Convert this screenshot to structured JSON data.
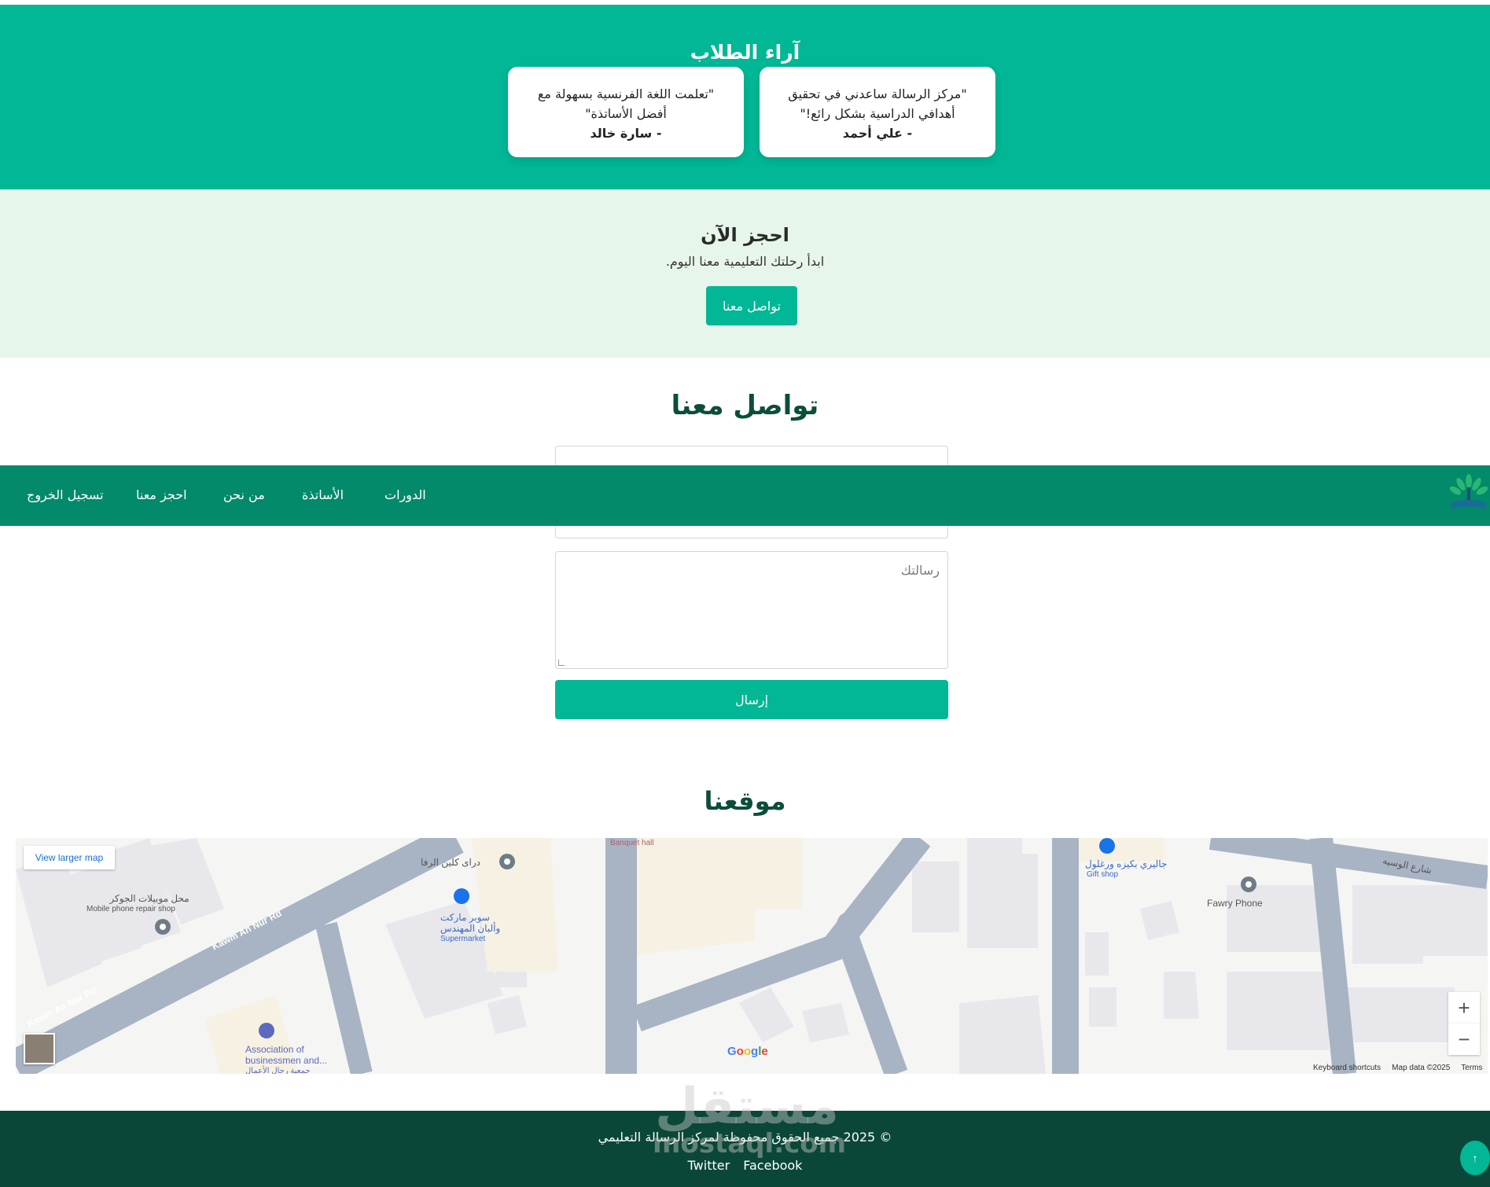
{
  "testimonials": {
    "title": "آراء الطلاب",
    "items": [
      {
        "quote": "\"مركز الرسالة ساعدني في تحقيق أهدافي الدراسية بشكل رائع!\"",
        "author": "- علي أحمد"
      },
      {
        "quote": "\"تعلمت اللغة الفرنسية بسهولة مع أفضل الأساتذة\"",
        "author": "- سارة خالد"
      }
    ]
  },
  "booking": {
    "title": "احجز الآن",
    "subtitle": "ابدأ رحلتك التعليمية معنا اليوم.",
    "cta_label": "تواصل معنا"
  },
  "contact": {
    "title": "تواصل معنا",
    "message_placeholder": "رسالتك",
    "submit_label": "إرسال"
  },
  "navbar": {
    "items": [
      "الدورات",
      "الأساتذة",
      "من نحن",
      "احجز معنا",
      "تسجيل الخروج"
    ],
    "logo_icon": "tree-book-logo-icon"
  },
  "location": {
    "title": "موقعنا",
    "map": {
      "larger_map_label": "View larger map",
      "zoom_in": "+",
      "zoom_out": "−",
      "google": "Google",
      "footer": [
        "Keyboard shortcuts",
        "Map data ©2025",
        "Terms"
      ],
      "labels": {
        "road1": "Kawm An Nur Rd",
        "road2": "Kawm An Nur Rd",
        "phone_shop_ar": "محل موبيلات الجوكر",
        "phone_shop_en": "Mobile phone repair shop",
        "cleaner": "دراى كلين الرفا",
        "super_ar1": "سوبر ماركت",
        "super_ar2": "وألبان المهندس",
        "super_en": "Supermarket",
        "banquet": "Banquet hall",
        "gallery_ar": "جاليري بكيزه ورغلول",
        "gallery_en": "Gift shop",
        "fawry": "Fawry Phone",
        "street_ar": "شارع الوسيه",
        "assoc1": "Association of",
        "assoc2": "businessmen and...",
        "assoc_ar": "جمعية رجال الأعمال"
      }
    }
  },
  "footer": {
    "copyright": "© 2025 جميع الحقوق محفوظة لمركز الرسالة التعليمي",
    "links": [
      "Twitter",
      "Facebook"
    ],
    "to_top": "↑"
  },
  "watermark": {
    "ar": "مستقل",
    "en": "mostaql.com"
  }
}
